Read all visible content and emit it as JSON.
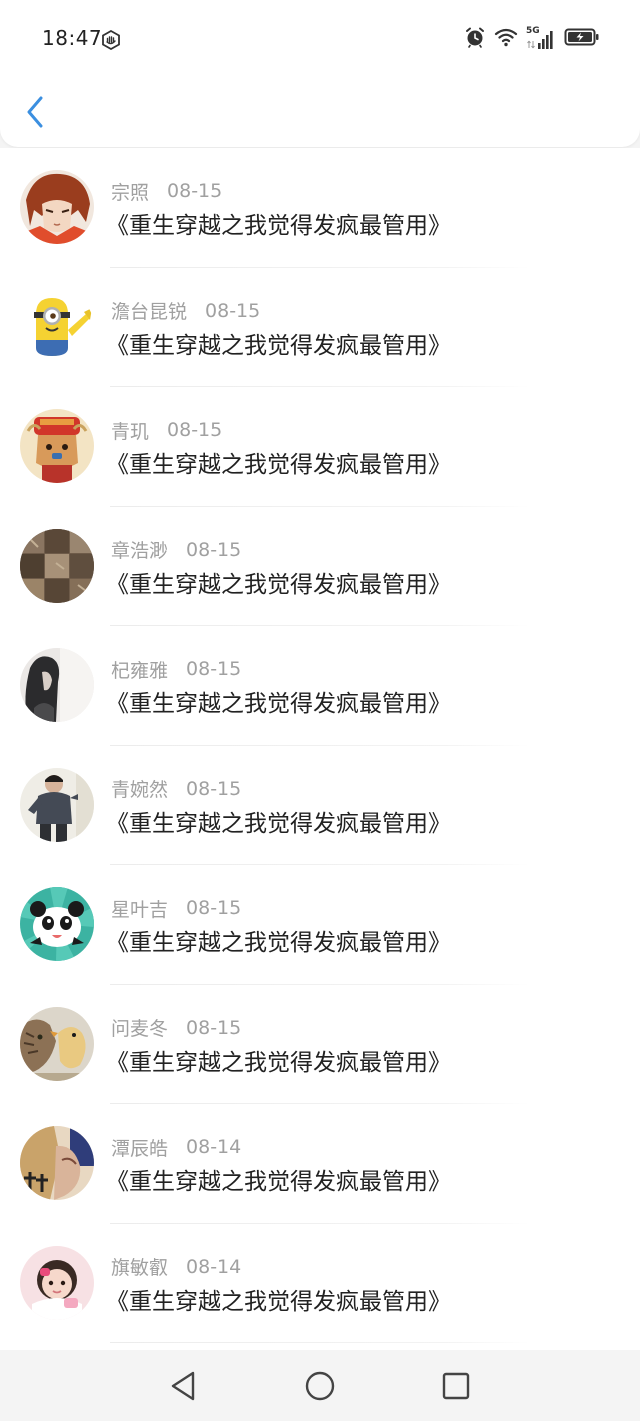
{
  "status_bar": {
    "time": "18:47",
    "network_label": "5G",
    "icons": [
      "vpn-hex-icon",
      "alarm-icon",
      "wifi-icon",
      "signal-icon",
      "battery-charging-icon"
    ]
  },
  "header": {
    "back_icon": "chevron-left-icon",
    "accent_color": "#3b8fe0"
  },
  "items": [
    {
      "name": "宗照",
      "date": "08-15",
      "title": "《重生穿越之我觉得发疯最管用》"
    },
    {
      "name": "澹台昆锐",
      "date": "08-15",
      "title": "《重生穿越之我觉得发疯最管用》"
    },
    {
      "name": "青玑",
      "date": "08-15",
      "title": "《重生穿越之我觉得发疯最管用》"
    },
    {
      "name": "章浩渺",
      "date": "08-15",
      "title": "《重生穿越之我觉得发疯最管用》"
    },
    {
      "name": "杞雍雅",
      "date": "08-15",
      "title": "《重生穿越之我觉得发疯最管用》"
    },
    {
      "name": "青婉然",
      "date": "08-15",
      "title": "《重生穿越之我觉得发疯最管用》"
    },
    {
      "name": "星叶吉",
      "date": "08-15",
      "title": "《重生穿越之我觉得发疯最管用》"
    },
    {
      "name": "问麦冬",
      "date": "08-15",
      "title": "《重生穿越之我觉得发疯最管用》"
    },
    {
      "name": "潭辰皓",
      "date": "08-14",
      "title": "《重生穿越之我觉得发疯最管用》"
    },
    {
      "name": "旗敏叡",
      "date": "08-14",
      "title": "《重生穿越之我觉得发疯最管用》"
    }
  ],
  "nav_bar": {
    "buttons": [
      "back-triangle-icon",
      "home-circle-icon",
      "recents-square-icon"
    ]
  }
}
